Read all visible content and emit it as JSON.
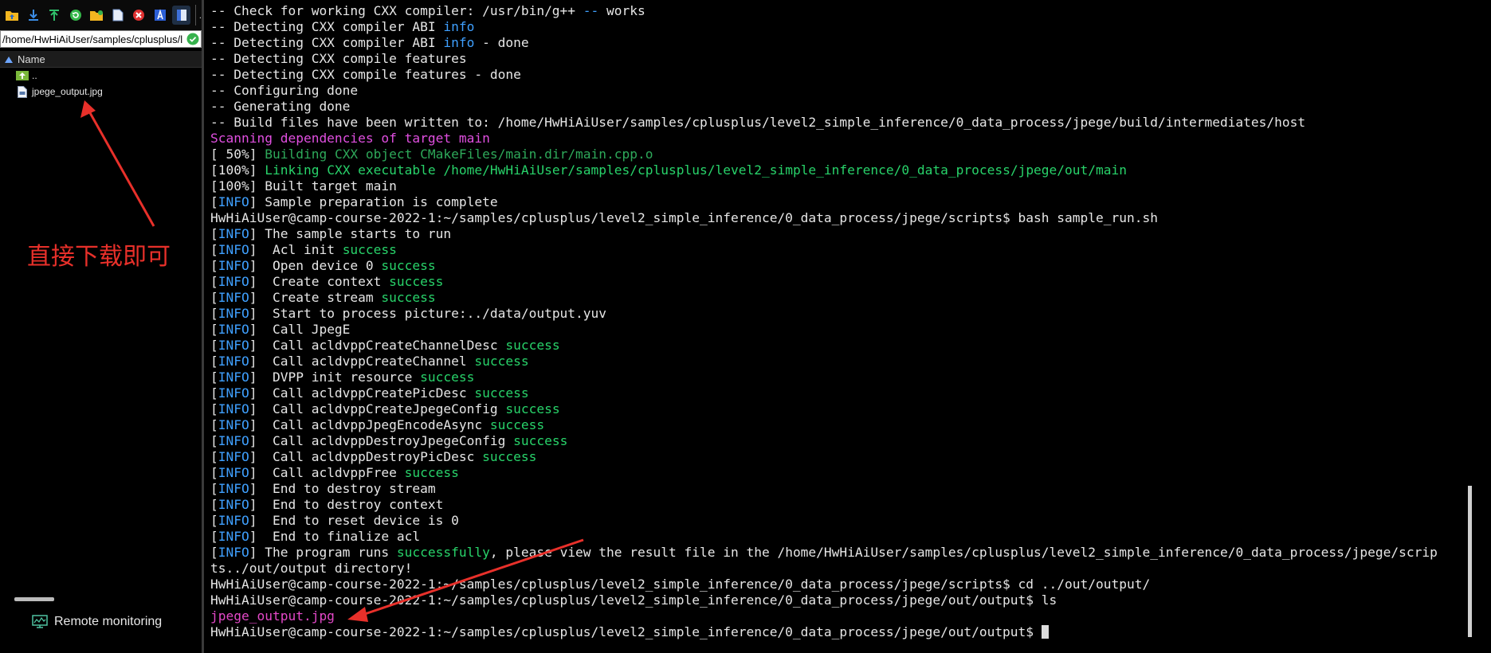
{
  "sftp_panel": {
    "path_value": "/home/HwHiAiUser/samples/cplusplus/l",
    "column_header": "Name",
    "files": [
      {
        "name": "..",
        "icon": "parent-folder-icon"
      },
      {
        "name": "jpege_output.jpg",
        "icon": "file-icon"
      }
    ],
    "annotation": "直接下载即可",
    "remote_monitoring_label": "Remote monitoring",
    "toolbar_more": "."
  },
  "colors": {
    "annotation_red": "#e8302a",
    "info_blue": "#3fa0ff",
    "success_green": "#28d36a",
    "cmake_magenta": "#e04fe0"
  },
  "terminal": {
    "lines": [
      [
        [
          "-- Check for working CXX compiler: /usr/bin/g++ ",
          "default"
        ],
        [
          "--",
          "blue"
        ],
        [
          " works",
          "default"
        ]
      ],
      [
        [
          "-- Detecting CXX compiler ABI ",
          "default"
        ],
        [
          "info",
          "blue"
        ]
      ],
      [
        [
          "-- Detecting CXX compiler ABI ",
          "default"
        ],
        [
          "info",
          "blue"
        ],
        [
          " - done",
          "default"
        ]
      ],
      [
        [
          "-- Detecting CXX compile features",
          "default"
        ]
      ],
      [
        [
          "-- Detecting CXX compile features - done",
          "default"
        ]
      ],
      [
        [
          "-- Configuring done",
          "default"
        ]
      ],
      [
        [
          "-- Generating done",
          "default"
        ]
      ],
      [
        [
          "-- Build files have been written to: /home/HwHiAiUser/samples/cplusplus/level2_simple_inference/0_data_process/jpege/build/intermediates/host",
          "default"
        ]
      ],
      [
        [
          "Scanning dependencies of target main",
          "magenta"
        ]
      ],
      [
        [
          "[ 50%] ",
          "default"
        ],
        [
          "Building CXX object CMakeFiles/main.dir/main.cpp.o",
          "dkgreen"
        ]
      ],
      [
        [
          "[100%] ",
          "default"
        ],
        [
          "Linking CXX executable /home/HwHiAiUser/samples/cplusplus/level2_simple_inference/0_data_process/jpege/out/main",
          "green"
        ]
      ],
      [
        [
          "[100%] Built target main",
          "default"
        ]
      ],
      [
        [
          "[",
          "default"
        ],
        [
          "INFO",
          "blue"
        ],
        [
          "] Sample preparation is complete",
          "default"
        ]
      ],
      [
        [
          "HwHiAiUser@camp-course-2022-1:~/samples/cplusplus/level2_simple_inference/0_data_process/jpege/scripts$ bash sample_run.sh",
          "default"
        ]
      ],
      [
        [
          "[",
          "default"
        ],
        [
          "INFO",
          "blue"
        ],
        [
          "] The sample starts to run",
          "default"
        ]
      ],
      [
        [
          "[",
          "default"
        ],
        [
          "INFO",
          "blue"
        ],
        [
          "]  Acl init ",
          "default"
        ],
        [
          "success",
          "green"
        ]
      ],
      [
        [
          "[",
          "default"
        ],
        [
          "INFO",
          "blue"
        ],
        [
          "]  Open device 0 ",
          "default"
        ],
        [
          "success",
          "green"
        ]
      ],
      [
        [
          "[",
          "default"
        ],
        [
          "INFO",
          "blue"
        ],
        [
          "]  Create context ",
          "default"
        ],
        [
          "success",
          "green"
        ]
      ],
      [
        [
          "[",
          "default"
        ],
        [
          "INFO",
          "blue"
        ],
        [
          "]  Create stream ",
          "default"
        ],
        [
          "success",
          "green"
        ]
      ],
      [
        [
          "[",
          "default"
        ],
        [
          "INFO",
          "blue"
        ],
        [
          "]  Start to process picture:../data/output.yuv",
          "default"
        ]
      ],
      [
        [
          "[",
          "default"
        ],
        [
          "INFO",
          "blue"
        ],
        [
          "]  Call JpegE",
          "default"
        ]
      ],
      [
        [
          "[",
          "default"
        ],
        [
          "INFO",
          "blue"
        ],
        [
          "]  Call acldvppCreateChannelDesc ",
          "default"
        ],
        [
          "success",
          "green"
        ]
      ],
      [
        [
          "[",
          "default"
        ],
        [
          "INFO",
          "blue"
        ],
        [
          "]  Call acldvppCreateChannel ",
          "default"
        ],
        [
          "success",
          "green"
        ]
      ],
      [
        [
          "[",
          "default"
        ],
        [
          "INFO",
          "blue"
        ],
        [
          "]  DVPP init resource ",
          "default"
        ],
        [
          "success",
          "green"
        ]
      ],
      [
        [
          "[",
          "default"
        ],
        [
          "INFO",
          "blue"
        ],
        [
          "]  Call acldvppCreatePicDesc ",
          "default"
        ],
        [
          "success",
          "green"
        ]
      ],
      [
        [
          "[",
          "default"
        ],
        [
          "INFO",
          "blue"
        ],
        [
          "]  Call acldvppCreateJpegeConfig ",
          "default"
        ],
        [
          "success",
          "green"
        ]
      ],
      [
        [
          "[",
          "default"
        ],
        [
          "INFO",
          "blue"
        ],
        [
          "]  Call acldvppJpegEncodeAsync ",
          "default"
        ],
        [
          "success",
          "green"
        ]
      ],
      [
        [
          "[",
          "default"
        ],
        [
          "INFO",
          "blue"
        ],
        [
          "]  Call acldvppDestroyJpegeConfig ",
          "default"
        ],
        [
          "success",
          "green"
        ]
      ],
      [
        [
          "[",
          "default"
        ],
        [
          "INFO",
          "blue"
        ],
        [
          "]  Call acldvppDestroyPicDesc ",
          "default"
        ],
        [
          "success",
          "green"
        ]
      ],
      [
        [
          "[",
          "default"
        ],
        [
          "INFO",
          "blue"
        ],
        [
          "]  Call acldvppFree ",
          "default"
        ],
        [
          "success",
          "green"
        ]
      ],
      [
        [
          "[",
          "default"
        ],
        [
          "INFO",
          "blue"
        ],
        [
          "]  End to destroy stream",
          "default"
        ]
      ],
      [
        [
          "[",
          "default"
        ],
        [
          "INFO",
          "blue"
        ],
        [
          "]  End to destroy context",
          "default"
        ]
      ],
      [
        [
          "[",
          "default"
        ],
        [
          "INFO",
          "blue"
        ],
        [
          "]  End to reset device is 0",
          "default"
        ]
      ],
      [
        [
          "[",
          "default"
        ],
        [
          "INFO",
          "blue"
        ],
        [
          "]  End to finalize acl",
          "default"
        ]
      ],
      [
        [
          "[",
          "default"
        ],
        [
          "INFO",
          "blue"
        ],
        [
          "] The program runs ",
          "default"
        ],
        [
          "successfully",
          "green"
        ],
        [
          ", please view the result file in the /home/HwHiAiUser/samples/cplusplus/level2_simple_inference/0_data_process/jpege/scrip",
          "default"
        ]
      ],
      [
        [
          "ts../out/output directory!",
          "default"
        ]
      ],
      [
        [
          "HwHiAiUser@camp-course-2022-1:~/samples/cplusplus/level2_simple_inference/0_data_process/jpege/scripts$ cd ../out/output/",
          "default"
        ]
      ],
      [
        [
          "HwHiAiUser@camp-course-2022-1:~/samples/cplusplus/level2_simple_inference/0_data_process/jpege/out/output$ ls",
          "default"
        ]
      ],
      [
        [
          "jpege_output.jpg",
          "pink"
        ]
      ],
      [
        [
          "HwHiAiUser@camp-course-2022-1:~/samples/cplusplus/level2_simple_inference/0_data_process/jpege/out/output$ ",
          "default"
        ]
      ]
    ]
  }
}
